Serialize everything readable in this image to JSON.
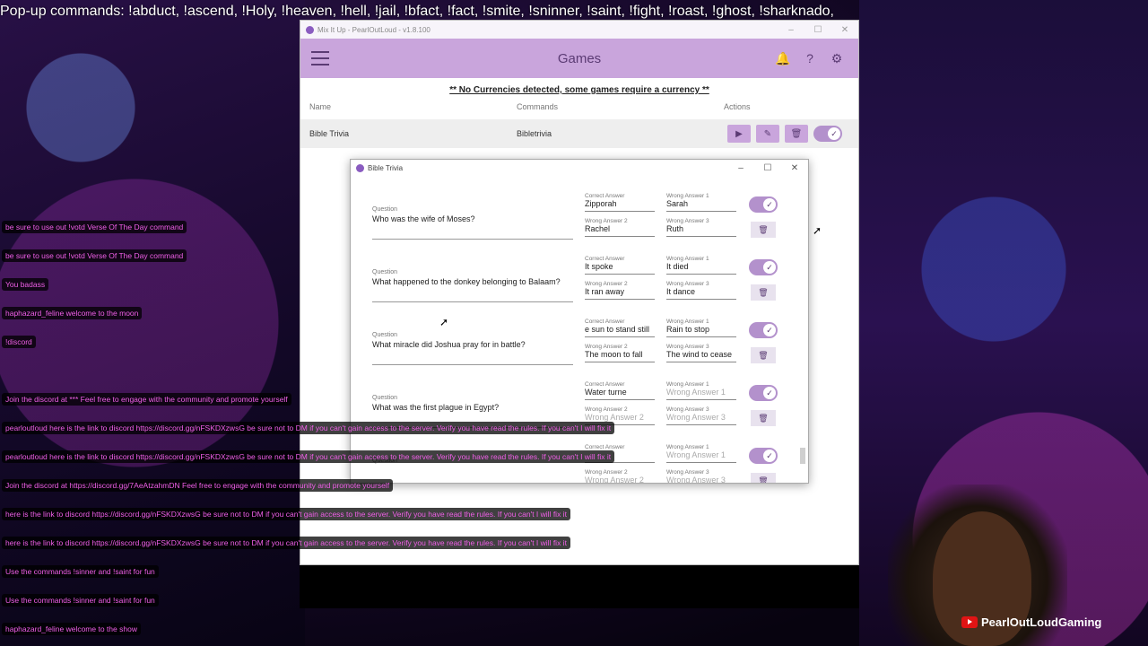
{
  "popup_banner": "Pop-up commands: !abduct, !ascend, !Holy, !heaven, !hell,  !jail, !bfact, !fact, !smite, !sninner, !saint, !fight, !roast, !ghost, !sharknado,",
  "app": {
    "window_title": "Mix It Up - PearlOutLoud - v1.8.100",
    "header_title": "Games",
    "notice": "** No Currencies detected, some games require a currency **",
    "columns": {
      "name": "Name",
      "commands": "Commands",
      "actions": "Actions"
    },
    "game_row": {
      "name": "Bible Trivia",
      "command": "Bibletrivia",
      "enabled": true
    }
  },
  "dialog": {
    "title": "Bible Trivia",
    "labels": {
      "question": "Question",
      "correct": "Correct Answer",
      "wrong1": "Wrong Answer 1",
      "wrong2": "Wrong Answer 2",
      "wrong3": "Wrong Answer 3"
    },
    "questions": [
      {
        "question": "Who was the wife of Moses?",
        "correct": "Zipporah",
        "wrong1": "Sarah",
        "wrong2": "Rachel",
        "wrong3": "Ruth",
        "enabled": true
      },
      {
        "question": "What happened to the donkey belonging to Balaam?",
        "correct": "It spoke",
        "wrong1": "It died",
        "wrong2": "It ran away",
        "wrong3": "It dance",
        "enabled": true
      },
      {
        "question": "What miracle did Joshua pray for in battle?",
        "correct": "e sun to stand still",
        "wrong1": "Rain to stop",
        "wrong2": "The moon to fall",
        "wrong3": "The wind to cease",
        "enabled": true
      },
      {
        "question": "What was the first plague in Egypt?",
        "correct": "Water turne",
        "wrong1": "Wrong Answer 1",
        "wrong2": "Wrong Answer 2",
        "wrong3": "Wrong Answer 3",
        "enabled": true
      },
      {
        "question": "",
        "correct": "",
        "wrong1": "Wrong Answer 1",
        "wrong2": "Wrong Answer 2",
        "wrong3": "Wrong Answer 3",
        "enabled": true
      }
    ]
  },
  "chat": [
    {
      "text": "be sure to use out !votd Verse Of The Day command"
    },
    {
      "text": "be sure to use out !votd Verse Of The Day command"
    },
    {
      "text": "You badass"
    },
    {
      "text": "haphazard_feline welcome to the moon"
    },
    {
      "text": "!discord"
    },
    {
      "text": "Join the discord at *** Feel free to engage with the community and promote yourself"
    },
    {
      "text": "pearloutloud here is the link to discord https://discord.gg/nFSKDXzwsG be sure not to DM if you can't gain access to the server. Verify you have read the rules. If you can't I will fix it"
    },
    {
      "text": "pearloutloud here is the link to discord https://discord.gg/nFSKDXzwsG be sure not to DM if you can't gain access to the server. Verify you have read the rules. If you can't I will fix it"
    },
    {
      "text": "Join the discord at https://discord.gg/7AeAtzahmDN Feel free to engage with the community and promote yourself"
    },
    {
      "text": "here is the link to discord https://discord.gg/nFSKDXzwsG be sure not to DM if you can't gain access to the server. Verify you have read the rules. If you can't I will fix it"
    },
    {
      "text": "here is the link to discord https://discord.gg/nFSKDXzwsG be sure not to DM if you can't gain access to the server. Verify you have read the rules. If you can't I will fix it"
    },
    {
      "text": "Use the commands !sinner and !saint for fun"
    },
    {
      "text": "Use the commands !sinner and !saint for fun"
    },
    {
      "text": "haphazard_feline welcome to the show"
    }
  ],
  "channel_name": "PearlOutLoudGaming",
  "colors": {
    "accent": "#c9a5dc",
    "accent_dark": "#5b3b74",
    "chat_text": "#f05fe8",
    "youtube_red": "#e01414"
  }
}
